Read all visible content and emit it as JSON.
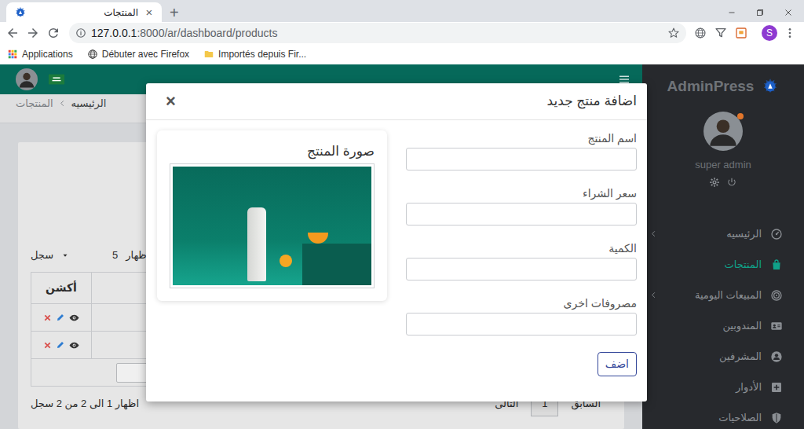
{
  "browser": {
    "tabs": [
      {
        "title": "المنتجات",
        "close": "×",
        "selected": true
      }
    ],
    "new_tab": "+",
    "url": {
      "host": "127.0.0.1",
      "path": ":8000/ar/dashboard/products"
    },
    "profile": "S",
    "bookmarks": [
      {
        "label": "Applications",
        "kind": "apps"
      },
      {
        "label": "Débuter avec Firefox",
        "kind": "page"
      },
      {
        "label": "Importés depuis Fir...",
        "kind": "folder"
      }
    ]
  },
  "sidebar": {
    "brand": "AdminPress",
    "user": "super admin",
    "items": [
      {
        "label": "الرئيسيه",
        "selected": false,
        "has_submenu": true
      },
      {
        "label": "المنتجات",
        "selected": true,
        "has_submenu": false
      },
      {
        "label": "المبيعات اليومية",
        "selected": false,
        "has_submenu": true
      },
      {
        "label": "المندوبين",
        "selected": false,
        "has_submenu": false
      },
      {
        "label": "المشرفين",
        "selected": false,
        "has_submenu": false
      },
      {
        "label": "الأدوار",
        "selected": false,
        "has_submenu": false
      },
      {
        "label": "الصلاحيات",
        "selected": false,
        "has_submenu": false
      }
    ]
  },
  "breadcrumb": [
    {
      "label": "الرئيسيه",
      "selected": false
    },
    {
      "label": "المنتجات",
      "selected": true
    }
  ],
  "table": {
    "length": {
      "before": "اظهار",
      "value": "5",
      "after": "سجل"
    },
    "columns": [
      "أكشن"
    ],
    "rows": [
      {
        "cells": []
      },
      {
        "cells": []
      }
    ],
    "info": "اظهار 1 الى 2 من 2 سجل",
    "pagination": {
      "previous": "السابق",
      "pages": [
        {
          "label": "1",
          "selected": true
        }
      ],
      "next": "التالى"
    }
  },
  "modal": {
    "title": "اضافة منتج جديد",
    "close": "×",
    "fields": [
      {
        "label": "اسم المنتج"
      },
      {
        "label": "سعر الشراء"
      },
      {
        "label": "الكمية"
      },
      {
        "label": "مصروفات اخرى"
      }
    ],
    "submit": "اضف",
    "image": {
      "title": "صورة المنتج"
    }
  }
}
